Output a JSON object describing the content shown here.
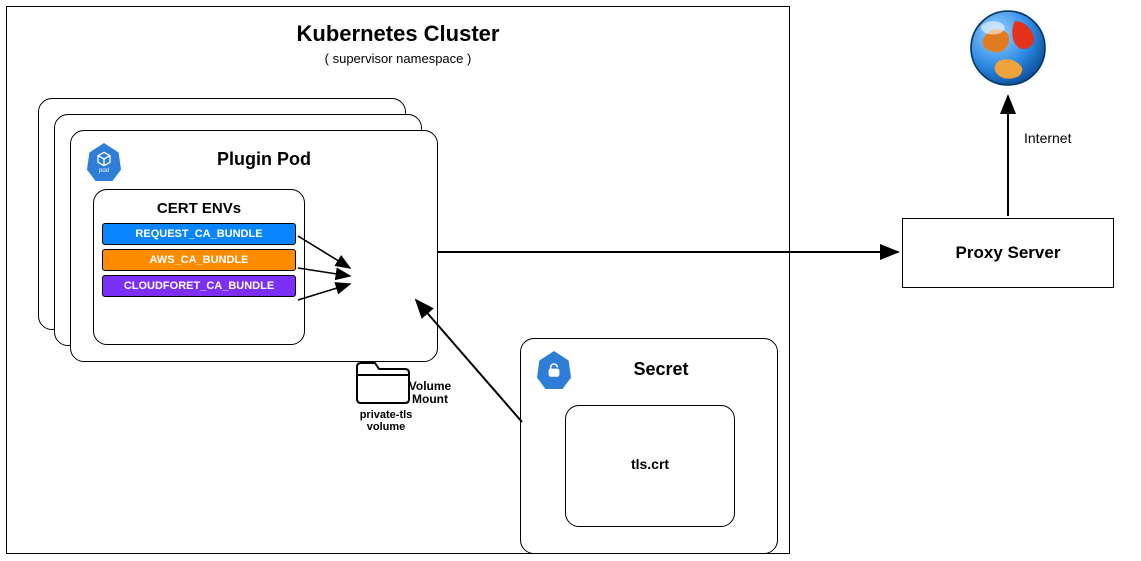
{
  "cluster": {
    "title": "Kubernetes Cluster",
    "subtitle": "( supervisor namespace )"
  },
  "pod": {
    "title": "Plugin Pod",
    "badge": "pod"
  },
  "cert_envs": {
    "title": "CERT ENVs",
    "items": [
      "REQUEST_CA_BUNDLE",
      "AWS_CA_BUNDLE",
      "CLOUDFORET_CA_BUNDLE"
    ]
  },
  "volume": {
    "label_line1": "private-tls",
    "label_line2": "volume"
  },
  "volume_mount": {
    "label_line1": "Volume",
    "label_line2": "Mount"
  },
  "secret": {
    "title": "Secret",
    "cert_file": "tls.crt"
  },
  "proxy": {
    "title": "Proxy Server"
  },
  "internet": {
    "label": "Internet"
  }
}
